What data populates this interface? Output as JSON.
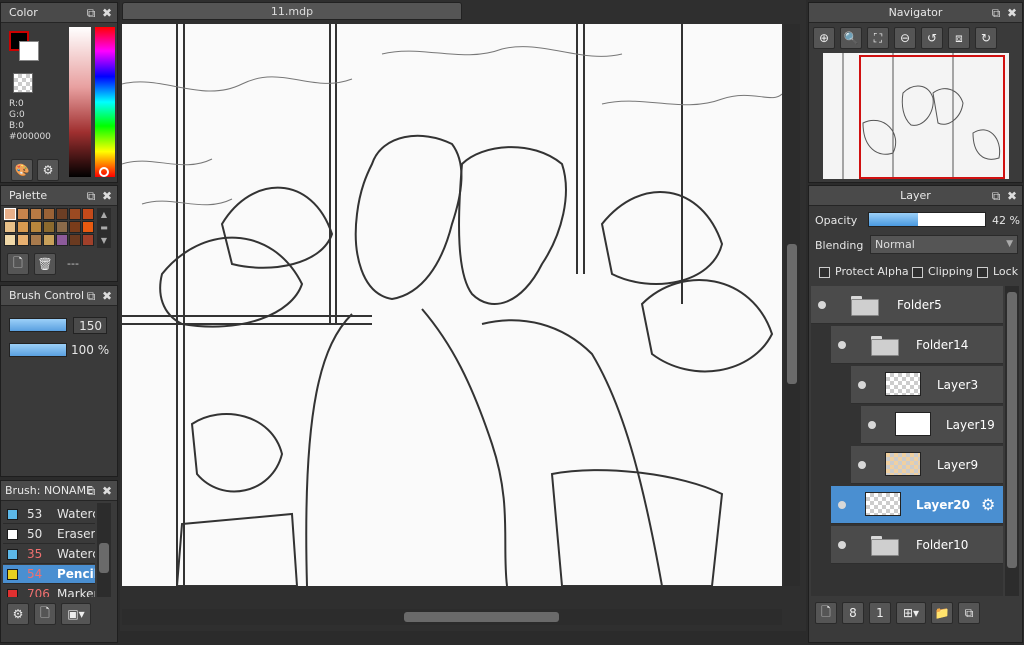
{
  "color_panel": {
    "title": "Color",
    "rgb": {
      "r": "R:0",
      "g": "G:0",
      "b": "B:0",
      "hex": "#000000"
    }
  },
  "palette_panel": {
    "title": "Palette",
    "empty_label": "---",
    "swatches": [
      "#e8b08a",
      "#c8844c",
      "#b87a44",
      "#9a6236",
      "#6c3e24",
      "#9b4a22",
      "#c44a1a",
      "#e8c088",
      "#d89a50",
      "#b8863c",
      "#8c6a2e",
      "#8a6a4a",
      "#7a3c1a",
      "#e85a10",
      "#f0d8a8",
      "#e8b070",
      "#a87a4c",
      "#c8a05a",
      "#8c5a9a",
      "#6a3a20",
      "#a0402a"
    ]
  },
  "brush_control": {
    "title": "Brush Control",
    "size_value": "150",
    "opacity_value": "100 %"
  },
  "brush_panel": {
    "title": "Brush: NONAME",
    "items": [
      {
        "num": "53",
        "name": "Waterc",
        "color": "#5cb8e8"
      },
      {
        "num": "50",
        "name": "Eraser",
        "color": "#ffffff"
      },
      {
        "num": "35",
        "name": "Waterc",
        "color": "#5cb8e8"
      },
      {
        "num": "54",
        "name": "Pencil",
        "color": "#e8d020"
      },
      {
        "num": "706",
        "name": "Marker",
        "color": "#e03030"
      }
    ]
  },
  "document": {
    "tab_title": "11.mdp"
  },
  "navigator": {
    "title": "Navigator"
  },
  "layer_panel": {
    "title": "Layer",
    "opacity_label": "Opacity",
    "opacity_value": "42 %",
    "opacity_level": 0.42,
    "blending_label": "Blending",
    "blending_value": "Normal",
    "protect_alpha": "Protect Alpha",
    "clipping": "Clipping",
    "lock": "Lock",
    "layers": [
      {
        "name": "Folder5"
      },
      {
        "name": "Folder14"
      },
      {
        "name": "Layer3"
      },
      {
        "name": "Layer19"
      },
      {
        "name": "Layer9"
      },
      {
        "name": "Layer20"
      },
      {
        "name": "Folder10"
      }
    ]
  },
  "icons": [
    "pop-out-icon",
    "close-icon",
    "zoom-in-icon",
    "zoom-out-icon",
    "fit-icon",
    "rotate-icon",
    "new-layer-icon",
    "trash-icon",
    "folder-icon",
    "gear-icon"
  ]
}
